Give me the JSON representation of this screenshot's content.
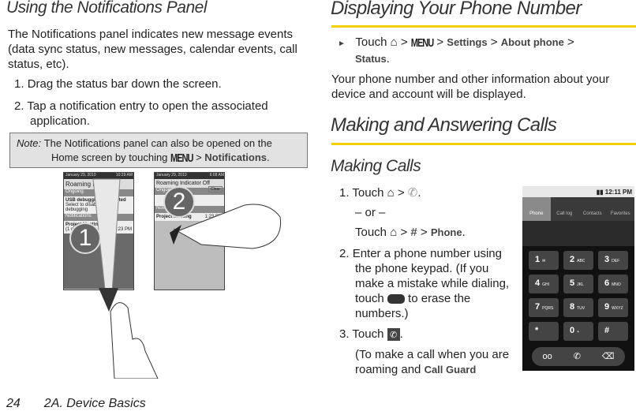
{
  "left": {
    "heading": "Using the Notifications Panel",
    "intro": "The Notifications panel indicates new message events (data sync status, new messages, calendar events, call status, etc).",
    "steps": [
      {
        "num": "1.",
        "text": "Drag the status bar down the screen."
      },
      {
        "num": "2.",
        "text": "Tap a notification entry to open the associated application."
      }
    ],
    "note": {
      "label": "Note:",
      "line1": "The Notifications panel can also be opened on the",
      "line2": "Home screen by touching",
      "menu": "MENU",
      "sep": ">",
      "target": "Notifications",
      "end": "."
    },
    "illustration": {
      "screen1": {
        "date": "January 29, 2010",
        "time": "10:29 AM",
        "title": "Roaming Indic",
        "ongoing": "Ongoing",
        "usb": "USB debugging connected",
        "usb_sub": "Select to disable USB debugging",
        "notifications": "Notifications",
        "item": "Project Meeting",
        "item_sub": "(1 more event)",
        "item_time": "1:23 PM"
      },
      "screen2": {
        "date": "January 29, 2010",
        "time": "6:08 AM",
        "title": "Roaming Indicator Off",
        "clear": "Clear",
        "ongoing": "Ongoing",
        "notifications": "Notifications",
        "item": "Project Meeting",
        "item_time": "1:23 PM"
      },
      "callouts": [
        "1",
        "2"
      ]
    }
  },
  "right": {
    "heading1": "Displaying Your Phone Number",
    "bullet": {
      "touch": "Touch",
      "menu": "MENU",
      "settings": "Settings",
      "about": "About phone",
      "status": "Status",
      "sep": ">"
    },
    "para": "Your phone number and other information about your device and account will be displayed.",
    "heading2": "Making and Answering Calls",
    "heading3": "Making Calls",
    "step1": {
      "num": "1.",
      "touch": "Touch",
      "or": "– or –",
      "phone": "Phone",
      "sep": ">"
    },
    "step2": {
      "num": "2.",
      "text1": "Enter a phone number using the phone keypad. (If you make a mistake while dialing, touch",
      "text2": "to erase the numbers.)"
    },
    "step3": {
      "num": "3.",
      "touch": "Touch",
      "end": "."
    },
    "step3_note": {
      "text": "(To make a call when you are roaming and",
      "bold": "Call Guard"
    }
  },
  "phone_screen": {
    "time": "12:11 PM",
    "tabs": [
      "Phone",
      "Call log",
      "Contacts",
      "Favorites"
    ],
    "active_tab": "Phone",
    "keys": [
      {
        "d": "1",
        "l": "✉"
      },
      {
        "d": "2",
        "l": "ABC"
      },
      {
        "d": "3",
        "l": "DEF"
      },
      {
        "d": "4",
        "l": "GHI"
      },
      {
        "d": "5",
        "l": "JKL"
      },
      {
        "d": "6",
        "l": "MNO"
      },
      {
        "d": "7",
        "l": "PQRS"
      },
      {
        "d": "8",
        "l": "TUV"
      },
      {
        "d": "9",
        "l": "WXYZ"
      },
      {
        "d": "*",
        "l": ""
      },
      {
        "d": "0",
        "l": "+"
      },
      {
        "d": "#",
        "l": ""
      }
    ]
  },
  "footer": {
    "page": "24",
    "section": "2A. Device Basics"
  },
  "colors": {
    "accent_rule": "#f5d000",
    "note_bg": "#e2e2e2"
  }
}
